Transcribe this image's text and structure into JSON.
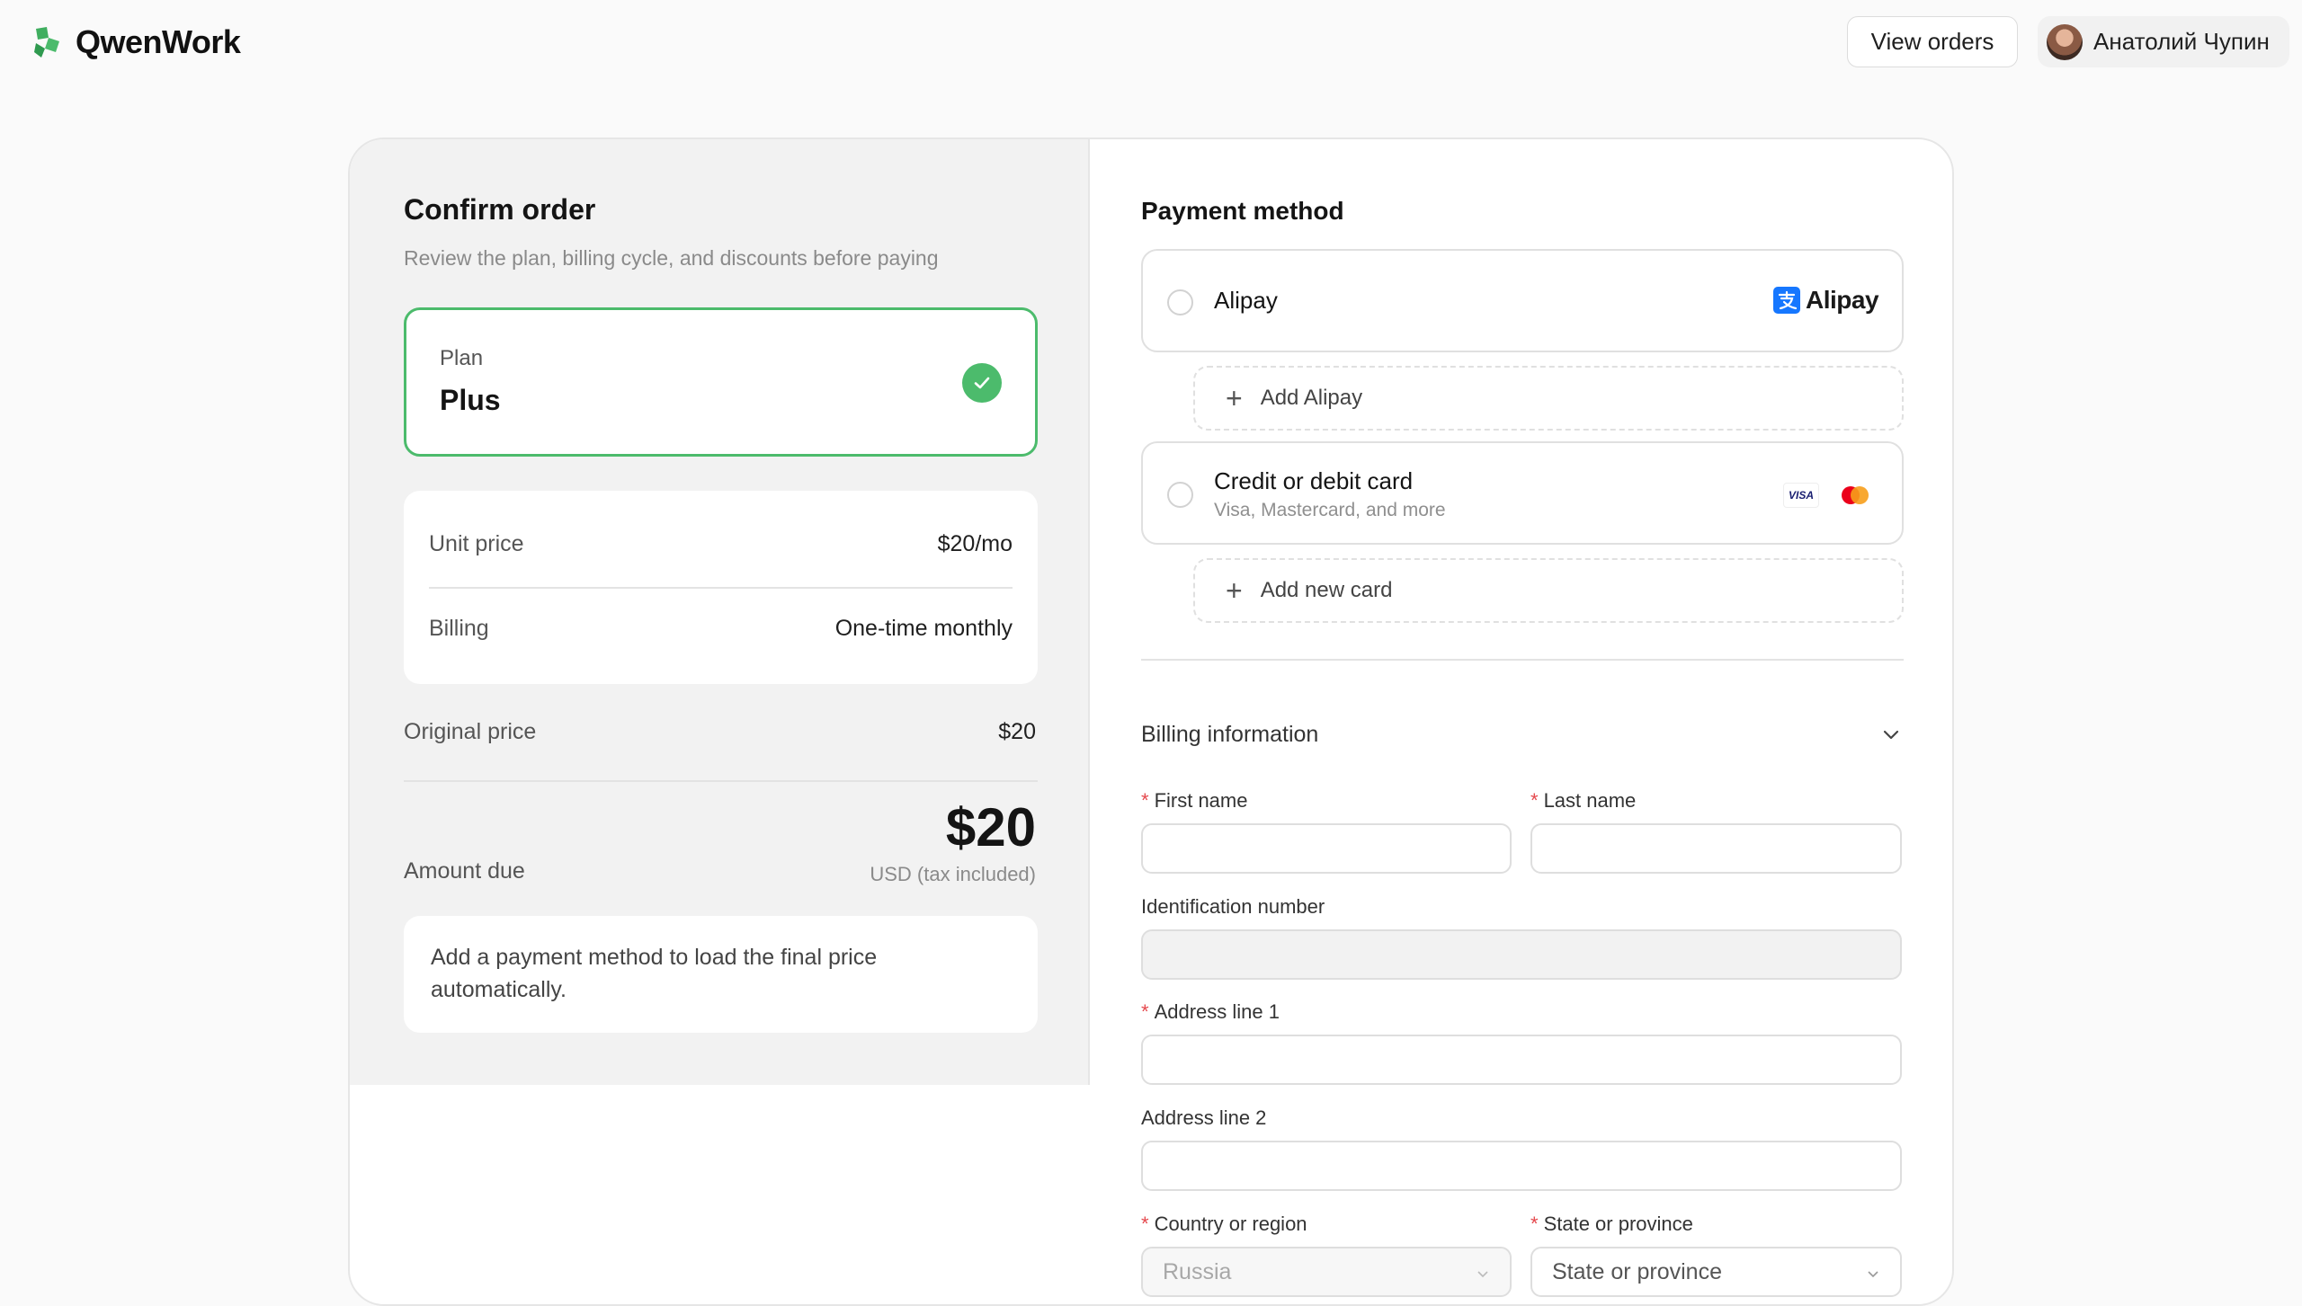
{
  "app": {
    "name": "QwenWork"
  },
  "header": {
    "view_orders_label": "View orders",
    "user_name": "Анатолий Чупин"
  },
  "order": {
    "title": "Confirm order",
    "subtitle": "Review the plan, billing cycle, and discounts before paying",
    "plan_label": "Plan",
    "plan_name": "Plus",
    "unit_price_label": "Unit price",
    "unit_price_value": "$20/mo",
    "billing_label": "Billing",
    "billing_value": "One-time monthly",
    "original_price_label": "Original price",
    "original_price_value": "$20",
    "amount_due_label": "Amount due",
    "amount_due_value": "$20",
    "tax_note": "USD (tax included)",
    "notice": "Add a payment method to load the final price automatically."
  },
  "payment": {
    "title": "Payment method",
    "alipay_label": "Alipay",
    "alipay_logo_text": "Alipay",
    "add_alipay_label": "Add Alipay",
    "card_label": "Credit or debit card",
    "card_sub": "Visa, Mastercard, and more",
    "visa_text": "VISA",
    "add_card_label": "Add new card"
  },
  "billing": {
    "title": "Billing information",
    "first_name_label": "First name",
    "last_name_label": "Last name",
    "id_label": "Identification number",
    "address1_label": "Address line 1",
    "address2_label": "Address line 2",
    "country_label": "Country or region",
    "country_value": "Russia",
    "state_label": "State or province",
    "state_placeholder": "State or province",
    "required_mark": "*"
  },
  "colors": {
    "accent_green": "#4cbb6c",
    "required_red": "#e5484d",
    "alipay_blue": "#1677ff"
  }
}
